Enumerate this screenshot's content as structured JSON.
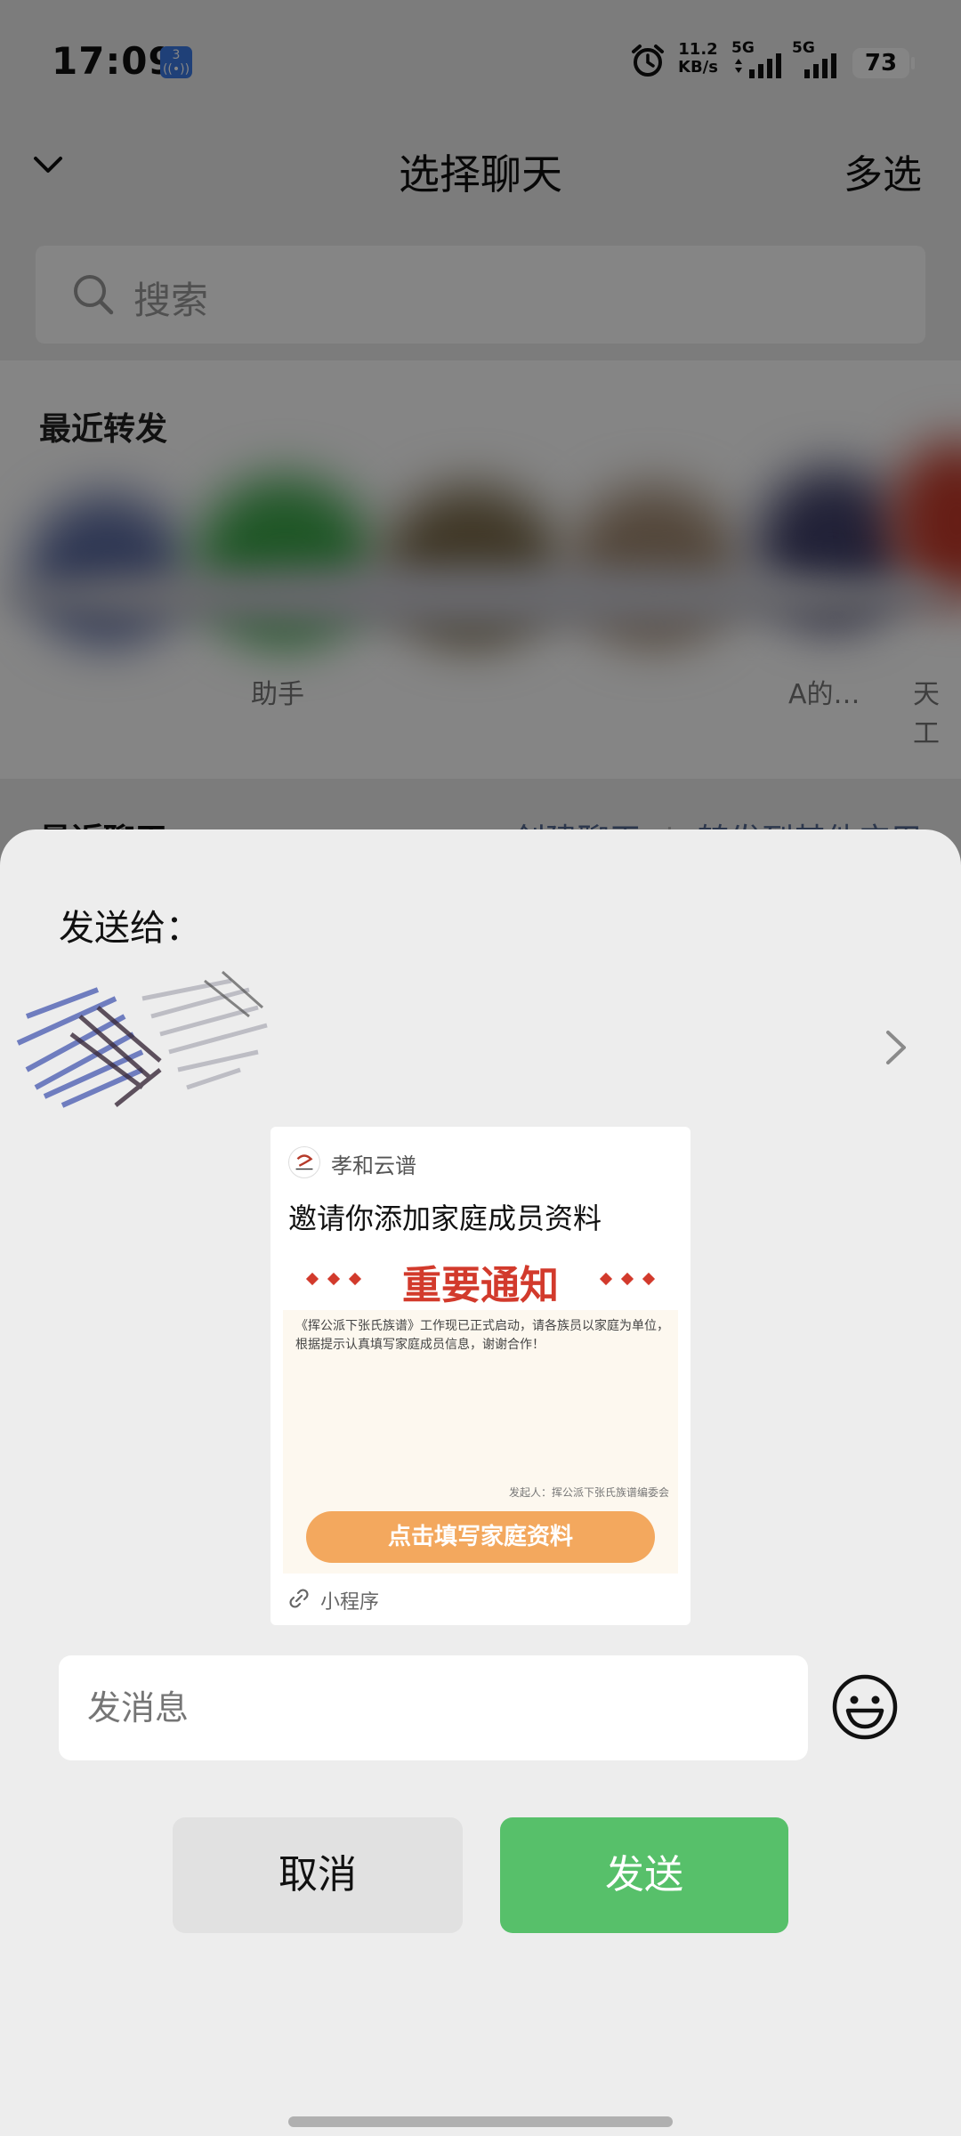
{
  "status_bar": {
    "time": "17:09",
    "hotspot_count": "3",
    "net_speed_value": "11.2",
    "net_speed_unit": "KB/s",
    "sim1_label": "5G",
    "sim2_label": "5G",
    "battery": "73"
  },
  "background": {
    "title": "选择聊天",
    "multi_select": "多选",
    "search_placeholder": "搜索",
    "recent_forward_title": "最近转发",
    "recent_forward_names": [
      "助手",
      "A的…",
      "天工"
    ],
    "recent_chats_title": "最近聊天",
    "create_chat": "创建聊天",
    "forward_other_app": "转发到其他应用"
  },
  "sheet": {
    "send_to_label": "发送给：",
    "card": {
      "app_name": "孝和云谱",
      "title": "邀请你添加家庭成员资料",
      "notice_heading": "重要通知",
      "notice_body": "《挥公派下张氏族谱》工作现已正式启动，请各族员以家庭为单位，根据提示认真填写家庭成员信息，谢谢合作！",
      "notice_sender": "发起人：挥公派下张氏族谱编委会",
      "button_label": "点击填写家庭资料",
      "footer_label": "小程序"
    },
    "message_placeholder": "发消息",
    "cancel_label": "取消",
    "send_label": "发送"
  },
  "colors": {
    "send_green": "#57c06a",
    "notice_red": "#d23a2c",
    "card_button_orange": "#f3a85e"
  },
  "icons": [
    "hotspot-icon",
    "alarm-icon",
    "signal-icon",
    "battery-icon",
    "chevron-down-icon",
    "search-icon",
    "chevron-right-icon",
    "link-icon",
    "emoji-icon"
  ]
}
